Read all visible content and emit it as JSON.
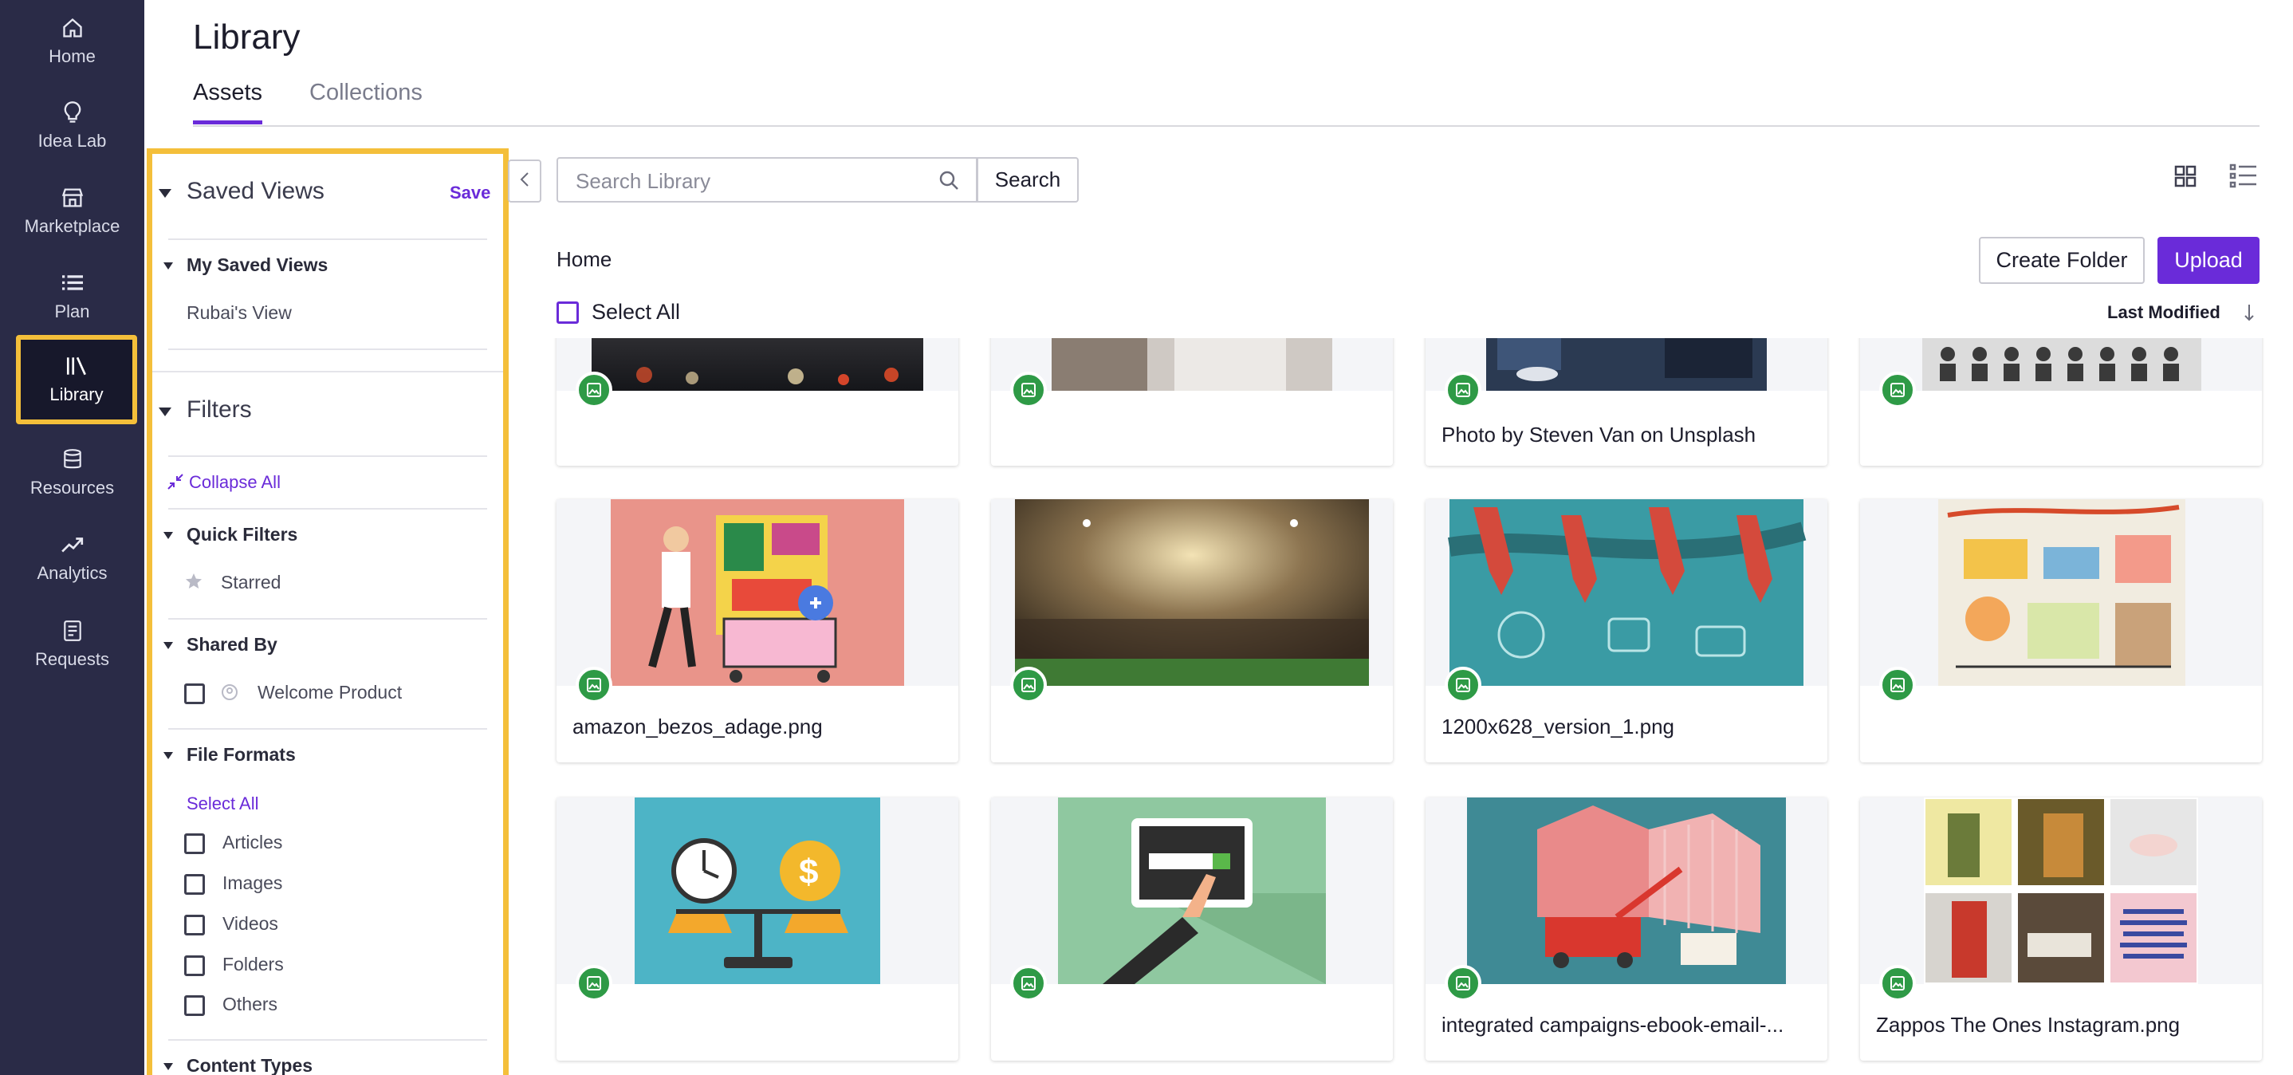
{
  "nav": {
    "items": [
      {
        "label": "Home",
        "icon": "home-icon"
      },
      {
        "label": "Idea Lab",
        "icon": "lightbulb-icon"
      },
      {
        "label": "Marketplace",
        "icon": "storefront-icon"
      },
      {
        "label": "Plan",
        "icon": "list-icon"
      },
      {
        "label": "Library",
        "icon": "library-icon",
        "active": true
      },
      {
        "label": "Resources",
        "icon": "database-icon"
      },
      {
        "label": "Analytics",
        "icon": "trending-up-icon"
      },
      {
        "label": "Requests",
        "icon": "document-icon"
      }
    ]
  },
  "header": {
    "title": "Library",
    "tabs": [
      {
        "label": "Assets",
        "active": true
      },
      {
        "label": "Collections",
        "active": false
      }
    ]
  },
  "filters": {
    "saved_views_title": "Saved Views",
    "save_label": "Save",
    "my_saved_views_title": "My Saved Views",
    "saved_view_item": "Rubai's View",
    "filters_title": "Filters",
    "collapse_all": "Collapse All",
    "quick_filters_title": "Quick Filters",
    "starred": "Starred",
    "shared_by_title": "Shared By",
    "shared_by_item": "Welcome Product",
    "file_formats_title": "File Formats",
    "select_all": "Select All",
    "formats": [
      "Articles",
      "Images",
      "Videos",
      "Folders",
      "Others"
    ],
    "next_section": "Content Types"
  },
  "toolbar": {
    "search_placeholder": "Search Library",
    "search_button": "Search",
    "breadcrumb": "Home",
    "create_folder": "Create Folder",
    "upload": "Upload",
    "select_all": "Select All",
    "sort": "Last Modified"
  },
  "assets": [
    {
      "name": ""
    },
    {
      "name": ""
    },
    {
      "name": "Photo by Steven Van on Unsplash"
    },
    {
      "name": ""
    },
    {
      "name": "amazon_bezos_adage.png"
    },
    {
      "name": ""
    },
    {
      "name": "1200x628_version_1.png"
    },
    {
      "name": ""
    },
    {
      "name": ""
    },
    {
      "name": ""
    },
    {
      "name": "integrated campaigns-ebook-email-..."
    },
    {
      "name": "Zappos The Ones Instagram.png"
    }
  ],
  "colors": {
    "nav_bg": "#2a2b47",
    "accent": "#6a2bd9",
    "highlight": "#f4bf3a",
    "badge": "#2e9a46"
  }
}
